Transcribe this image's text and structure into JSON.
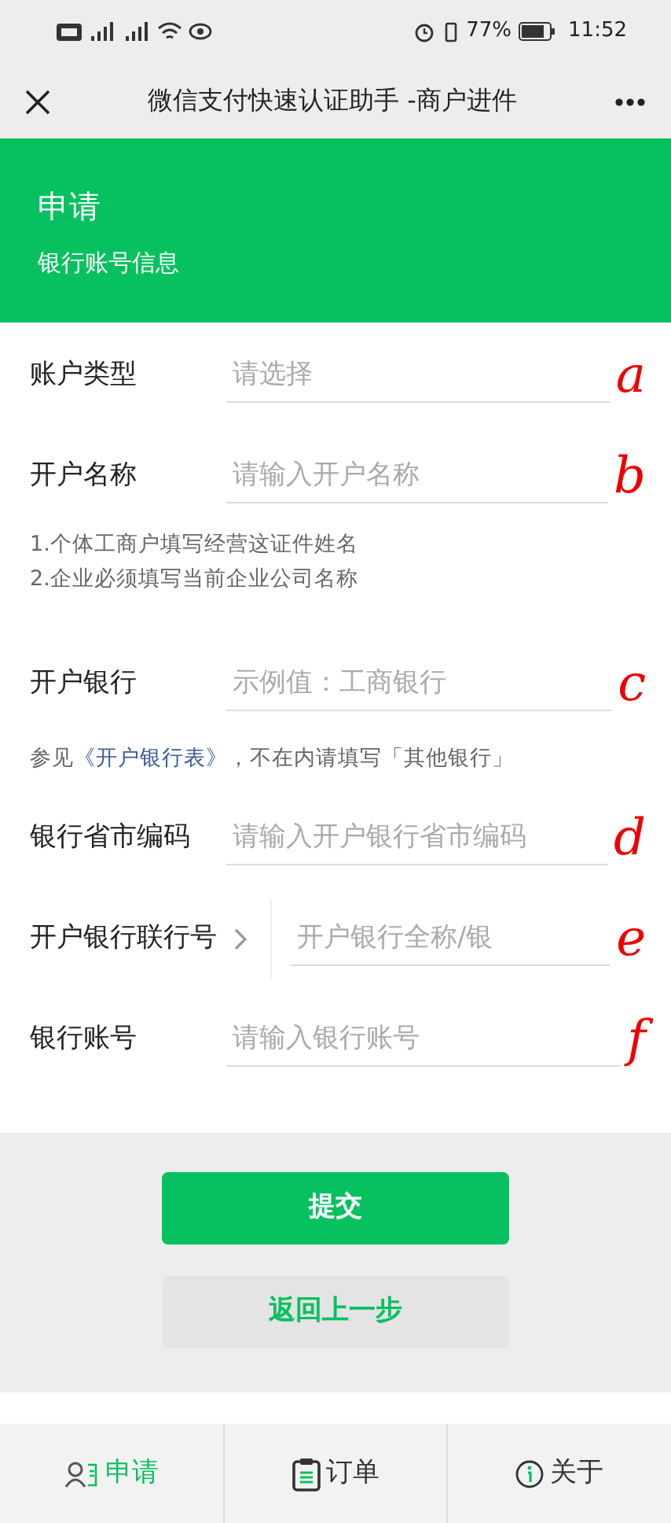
{
  "status_bar": {
    "battery": "77%",
    "time": "11:52"
  },
  "nav": {
    "title": "微信支付快速认证助手 -商户进件"
  },
  "header": {
    "title": "申请",
    "subtitle": "银行账号信息"
  },
  "form": [
    {
      "kind": "field",
      "label": "账户类型",
      "placeholder": "请选择",
      "annotation": "a"
    },
    {
      "kind": "field",
      "label": "开户名称",
      "placeholder": "请输入开户名称",
      "annotation": "b"
    },
    {
      "kind": "hint",
      "lines": [
        "1.个体工商户填写经营这证件姓名",
        "2.企业必须填写当前企业公司名称"
      ]
    },
    {
      "kind": "field",
      "label": "开户银行",
      "placeholder": "示例值：工商银行",
      "annotation": "c"
    },
    {
      "kind": "note",
      "before": "参见",
      "link": "《开户银行表》",
      "after": "，不在内请填写「其他银行」"
    },
    {
      "kind": "field",
      "label": "银行省市编码",
      "placeholder": "请输入开户银行省市编码",
      "annotation": "d"
    },
    {
      "kind": "picker",
      "label": "开户银行联行号",
      "placeholder": "开户银行全称/银",
      "annotation": "e"
    },
    {
      "kind": "field",
      "label": "银行账号",
      "placeholder": "请输入银行账号",
      "annotation": "f"
    }
  ],
  "buttons": [
    {
      "label": "提交",
      "kind": "primary"
    },
    {
      "label": "返回上一步",
      "kind": "secondary"
    }
  ],
  "tabbar": [
    {
      "label": "申请",
      "selected": true
    },
    {
      "label": "订单",
      "selected": false
    },
    {
      "label": "关于",
      "selected": false
    }
  ]
}
